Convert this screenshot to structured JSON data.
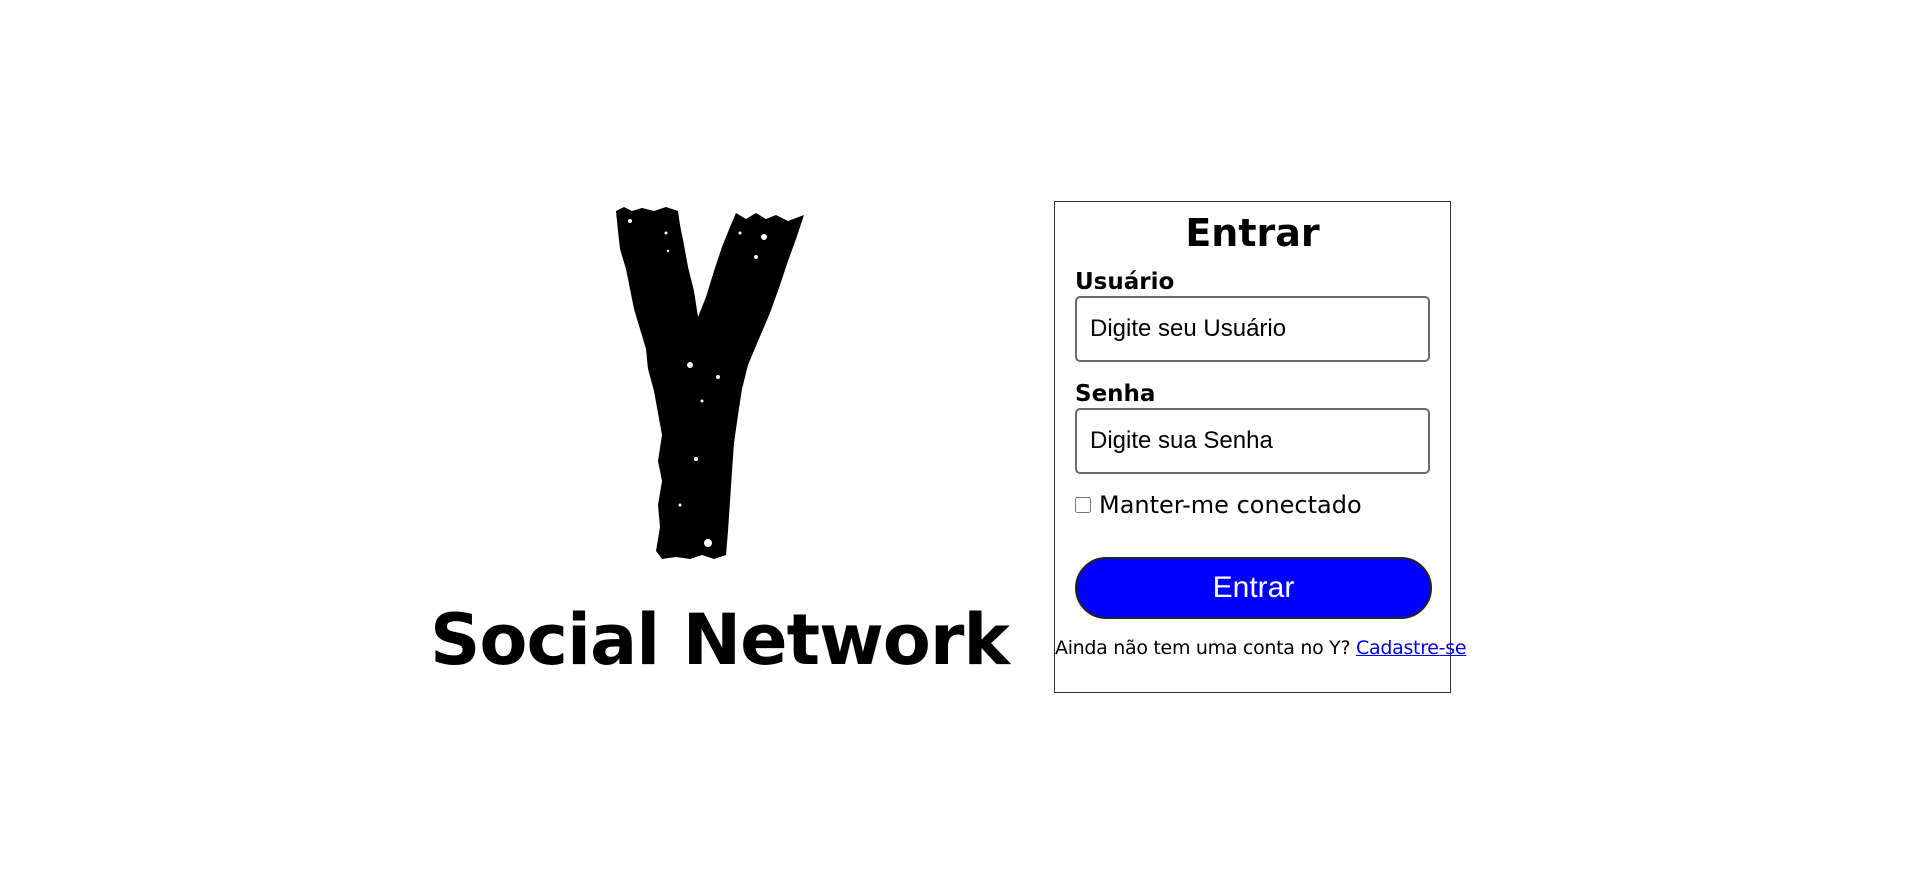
{
  "brand": {
    "logo_icon": "y-logo-icon",
    "logo_letter": "Y",
    "name": "Social Network"
  },
  "login": {
    "title": "Entrar",
    "username": {
      "label": "Usuário",
      "placeholder": "Digite seu Usuário",
      "value": ""
    },
    "password": {
      "label": "Senha",
      "placeholder": "Digite sua Senha",
      "value": ""
    },
    "remember": {
      "label": "Manter-me conectado",
      "checked": false
    },
    "submit_label": "Entrar",
    "signup_prompt": "Ainda não tem uma conta no Y?",
    "signup_link": "Cadastre-se"
  },
  "colors": {
    "primary_button": "#0000ff",
    "link": "#0000ee",
    "text": "#000000",
    "background": "#ffffff"
  }
}
